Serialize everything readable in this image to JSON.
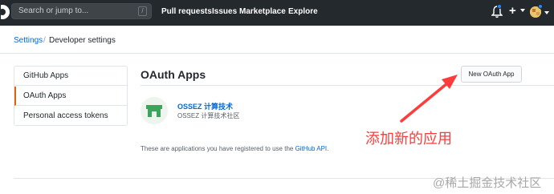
{
  "header": {
    "search_placeholder": "Search or jump to...",
    "search_shortcut": "/",
    "nav": [
      "Pull requests",
      "Issues",
      "Marketplace",
      "Explore"
    ],
    "plus_label": "+"
  },
  "breadcrumb": {
    "settings": "Settings",
    "separator": "/",
    "current": "Developer settings"
  },
  "sidebar": {
    "items": [
      {
        "label": "GitHub Apps"
      },
      {
        "label": "OAuth Apps"
      },
      {
        "label": "Personal access tokens"
      }
    ],
    "active_accent": "#e36209"
  },
  "main": {
    "title": "OAuth Apps",
    "new_button": "New OAuth App",
    "app": {
      "name": "OSSEZ 计算技术",
      "description": "OSSEZ 计算技术社区"
    },
    "footnote_prefix": "These are applications you have registered to use the ",
    "footnote_link": "GitHub API",
    "footnote_suffix": "."
  },
  "annotation": {
    "text": "添加新的应用",
    "color": "#ff3b3b"
  },
  "watermark": "@稀土掘金技术社区",
  "colors": {
    "topbar": "#24292e",
    "link": "#0366d6",
    "border": "#e1e4e8"
  }
}
